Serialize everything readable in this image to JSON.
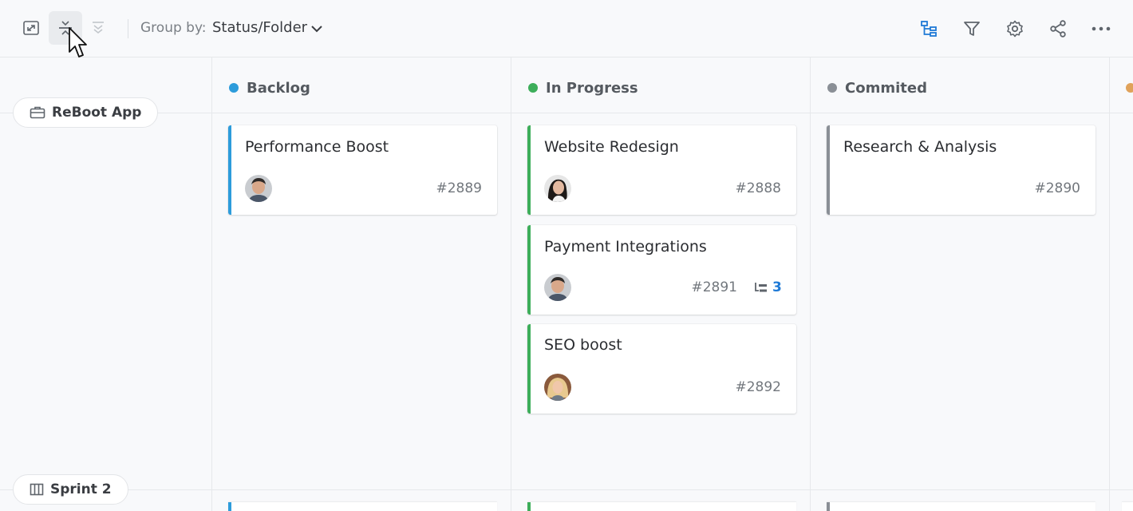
{
  "toolbar": {
    "group_by_label": "Group by:",
    "group_by_value": "Status/Folder"
  },
  "columns": [
    {
      "label": "Backlog",
      "color": "#2d9cdb"
    },
    {
      "label": "In Progress",
      "color": "#3dae5a"
    },
    {
      "label": "Commited",
      "color": "#8a8f96"
    },
    {
      "label": "",
      "color": "#e0a25a"
    }
  ],
  "groups": [
    {
      "label": "ReBoot App",
      "icon": "briefcase-icon"
    },
    {
      "label": "Sprint 2",
      "icon": "board-icon"
    }
  ],
  "cards": [
    {
      "title": "Performance Boost",
      "number": "#2889",
      "column": "Backlog",
      "assignee": "male-avatar"
    },
    {
      "title": "Website Redesign",
      "number": "#2888",
      "column": "In Progress",
      "assignee": "female-avatar"
    },
    {
      "title": "Payment Integrations",
      "number": "#2891",
      "column": "In Progress",
      "assignee": "male-avatar",
      "subtasks": "3"
    },
    {
      "title": "SEO boost",
      "number": "#2892",
      "column": "In Progress",
      "assignee": "blonde-avatar"
    },
    {
      "title": "Research & Analysis",
      "number": "#2890",
      "column": "Commited",
      "assignee": ""
    }
  ],
  "colors": {
    "accent": "#1f7ad6",
    "backlog": "#2d9cdb",
    "in_progress": "#3dae5a",
    "commited": "#8a8f96"
  }
}
